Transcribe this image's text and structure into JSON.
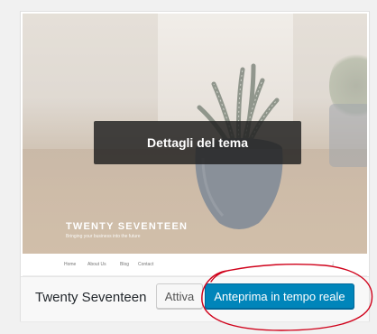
{
  "theme_card": {
    "screenshot": {
      "site_title": "TWENTY SEVENTEEN",
      "site_tagline": "Bringing your business into the future",
      "nav_items": [
        "Home",
        "About Us",
        "Blog",
        "Contact"
      ],
      "scroll_arrow": "↓"
    },
    "details_button_label": "Dettagli del tema",
    "theme_name": "Twenty Seventeen",
    "activate_label": "Attiva",
    "preview_label": "Anteprima in tempo reale"
  },
  "colors": {
    "primary_button": "#0085ba",
    "annotation_circle": "#d0021b",
    "details_overlay": "#1e1e1e"
  }
}
